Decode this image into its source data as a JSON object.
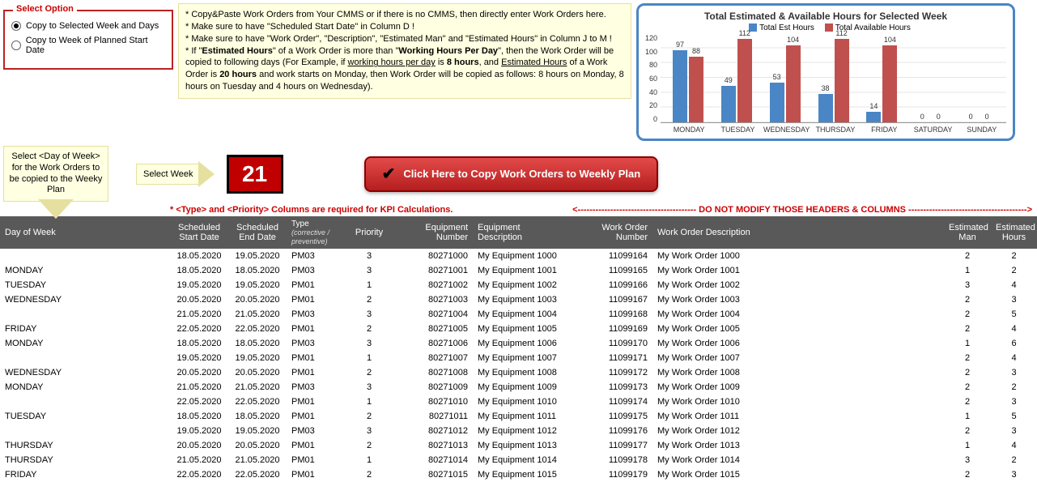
{
  "select_option": {
    "legend": "Select Option",
    "opt1": "Copy to Selected Week and Days",
    "opt2": "Copy to Week of Planned Start Date",
    "selected": 1
  },
  "notes": {
    "l1": "* Copy&Paste Work Orders from Your CMMS or if there is no CMMS, then directly enter Work Orders here.",
    "l2": "* Make sure to have \"Scheduled Start Date\" in Column D !",
    "l3": "* Make sure to have \"Work Order\", \"Description\", \"Estimated Man\" and \"Estimated Hours\" in Column J to M !",
    "l4a": "* If \"",
    "l4b": "Estimated Hours",
    "l4c": "\" of a Work Order is more than \"",
    "l4d": "Working Hours Per Day",
    "l4e": "\", then the Work Order will be copied to following days (For Example, if ",
    "l4f": "working hours per day",
    "l4g": " is ",
    "l4h": "8 hours",
    "l4i": ", and ",
    "l4j": "Estimated Hours",
    "l4k": " of a Work Order is ",
    "l4l": "20 hours",
    "l4m": " and work starts on Monday, then Work Order will be copied as follows: 8 hours on Monday, 8 hours on Tuesday and 4 hours on Wednesday)."
  },
  "callout_dow": "Select <Day of Week> for the Work Orders to be copied to the Weeky Plan",
  "select_week_label": "Select Week",
  "week_number": "21",
  "copy_button": "Click Here to Copy Work Orders to Weekly Plan",
  "warn_left": "* <Type> and <Priority> Columns are required for KPI Calculations.",
  "warn_right": "<---------------------------------------- DO NOT MODIFY THOSE HEADERS & COLUMNS ---------------------------------------->",
  "headers": {
    "dow": "Day of Week",
    "sd1": "Scheduled",
    "sd2": "Start Date",
    "ed1": "Scheduled",
    "ed2": "End Date",
    "type1": "Type",
    "type2": "(corrective / preventive)",
    "pri": "Priority",
    "eqn1": "Equipment",
    "eqn2": "Number",
    "eqd1": "Equipment",
    "eqd2": "Description",
    "won1": "Work Order",
    "won2": "Number",
    "wod": "Work Order Description",
    "em1": "Estimated",
    "em2": "Man",
    "eh1": "Estimated",
    "eh2": "Hours"
  },
  "rows": [
    {
      "dow": "",
      "sd": "18.05.2020",
      "ed": "19.05.2020",
      "type": "PM03",
      "pri": "3",
      "eqn": "80271000",
      "eqd": "My Equipment 1000",
      "won": "11099164",
      "wod": "My Work Order 1000",
      "em": "2",
      "eh": "2"
    },
    {
      "dow": "MONDAY",
      "sd": "18.05.2020",
      "ed": "18.05.2020",
      "type": "PM03",
      "pri": "3",
      "eqn": "80271001",
      "eqd": "My Equipment 1001",
      "won": "11099165",
      "wod": "My Work Order 1001",
      "em": "1",
      "eh": "2"
    },
    {
      "dow": "TUESDAY",
      "sd": "19.05.2020",
      "ed": "19.05.2020",
      "type": "PM01",
      "pri": "1",
      "eqn": "80271002",
      "eqd": "My Equipment 1002",
      "won": "11099166",
      "wod": "My Work Order 1002",
      "em": "3",
      "eh": "4"
    },
    {
      "dow": "WEDNESDAY",
      "sd": "20.05.2020",
      "ed": "20.05.2020",
      "type": "PM01",
      "pri": "2",
      "eqn": "80271003",
      "eqd": "My Equipment 1003",
      "won": "11099167",
      "wod": "My Work Order 1003",
      "em": "2",
      "eh": "3"
    },
    {
      "dow": "",
      "sd": "21.05.2020",
      "ed": "21.05.2020",
      "type": "PM03",
      "pri": "3",
      "eqn": "80271004",
      "eqd": "My Equipment 1004",
      "won": "11099168",
      "wod": "My Work Order 1004",
      "em": "2",
      "eh": "5"
    },
    {
      "dow": "FRIDAY",
      "sd": "22.05.2020",
      "ed": "22.05.2020",
      "type": "PM01",
      "pri": "2",
      "eqn": "80271005",
      "eqd": "My Equipment 1005",
      "won": "11099169",
      "wod": "My Work Order 1005",
      "em": "2",
      "eh": "4"
    },
    {
      "dow": "MONDAY",
      "sd": "18.05.2020",
      "ed": "18.05.2020",
      "type": "PM03",
      "pri": "3",
      "eqn": "80271006",
      "eqd": "My Equipment 1006",
      "won": "11099170",
      "wod": "My Work Order 1006",
      "em": "1",
      "eh": "6"
    },
    {
      "dow": "",
      "sd": "19.05.2020",
      "ed": "19.05.2020",
      "type": "PM01",
      "pri": "1",
      "eqn": "80271007",
      "eqd": "My Equipment 1007",
      "won": "11099171",
      "wod": "My Work Order 1007",
      "em": "2",
      "eh": "4"
    },
    {
      "dow": "WEDNESDAY",
      "sd": "20.05.2020",
      "ed": "20.05.2020",
      "type": "PM01",
      "pri": "2",
      "eqn": "80271008",
      "eqd": "My Equipment 1008",
      "won": "11099172",
      "wod": "My Work Order 1008",
      "em": "2",
      "eh": "3"
    },
    {
      "dow": "MONDAY",
      "sd": "21.05.2020",
      "ed": "21.05.2020",
      "type": "PM03",
      "pri": "3",
      "eqn": "80271009",
      "eqd": "My Equipment 1009",
      "won": "11099173",
      "wod": "My Work Order 1009",
      "em": "2",
      "eh": "2"
    },
    {
      "dow": "",
      "sd": "22.05.2020",
      "ed": "22.05.2020",
      "type": "PM01",
      "pri": "1",
      "eqn": "80271010",
      "eqd": "My Equipment 1010",
      "won": "11099174",
      "wod": "My Work Order 1010",
      "em": "2",
      "eh": "3"
    },
    {
      "dow": "TUESDAY",
      "sd": "18.05.2020",
      "ed": "18.05.2020",
      "type": "PM01",
      "pri": "2",
      "eqn": "80271011",
      "eqd": "My Equipment 1011",
      "won": "11099175",
      "wod": "My Work Order 1011",
      "em": "1",
      "eh": "5"
    },
    {
      "dow": "",
      "sd": "19.05.2020",
      "ed": "19.05.2020",
      "type": "PM03",
      "pri": "3",
      "eqn": "80271012",
      "eqd": "My Equipment 1012",
      "won": "11099176",
      "wod": "My Work Order 1012",
      "em": "2",
      "eh": "3"
    },
    {
      "dow": "THURSDAY",
      "sd": "20.05.2020",
      "ed": "20.05.2020",
      "type": "PM01",
      "pri": "2",
      "eqn": "80271013",
      "eqd": "My Equipment 1013",
      "won": "11099177",
      "wod": "My Work Order 1013",
      "em": "1",
      "eh": "4"
    },
    {
      "dow": "THURSDAY",
      "sd": "21.05.2020",
      "ed": "21.05.2020",
      "type": "PM01",
      "pri": "1",
      "eqn": "80271014",
      "eqd": "My Equipment 1014",
      "won": "11099178",
      "wod": "My Work Order 1014",
      "em": "3",
      "eh": "2"
    },
    {
      "dow": "FRIDAY",
      "sd": "22.05.2020",
      "ed": "22.05.2020",
      "type": "PM01",
      "pri": "2",
      "eqn": "80271015",
      "eqd": "My Equipment 1015",
      "won": "11099179",
      "wod": "My Work Order 1015",
      "em": "2",
      "eh": "3"
    }
  ],
  "chart_data": {
    "type": "bar",
    "title": "Total Estimated & Available Hours for Selected Week",
    "legend": [
      "Total Est Hours",
      "Total Available Hours"
    ],
    "categories": [
      "MONDAY",
      "TUESDAY",
      "WEDNESDAY",
      "THURSDAY",
      "FRIDAY",
      "SATURDAY",
      "SUNDAY"
    ],
    "series": [
      {
        "name": "Total Est Hours",
        "color": "#4a86c5",
        "values": [
          97,
          49,
          53,
          38,
          14,
          0,
          0
        ]
      },
      {
        "name": "Total Available Hours",
        "color": "#c0504d",
        "values": [
          88,
          112,
          104,
          112,
          104,
          0,
          0
        ]
      }
    ],
    "ylim": [
      0,
      120
    ],
    "yticks": [
      0,
      20,
      40,
      60,
      80,
      100,
      120
    ]
  }
}
